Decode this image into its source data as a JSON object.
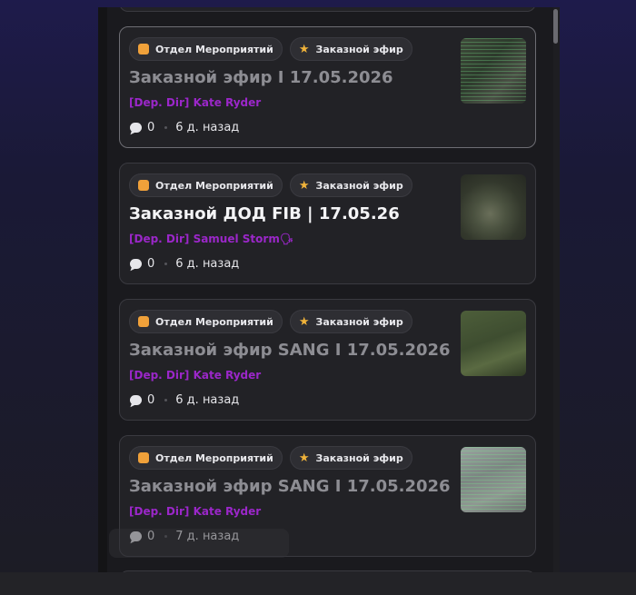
{
  "feed": {
    "cards": [
      {
        "tags": [
          {
            "label": "Отдел Мероприятий",
            "icon": "orange-square-icon"
          },
          {
            "label": "Заказной эфир",
            "icon": "star-icon"
          }
        ],
        "title": "Заказной эфир I 17.05.2026",
        "author": "[Dep. Dir] Kate Ryder",
        "comments": "0",
        "time": "6 д. назад",
        "title_bright": false,
        "active": true
      },
      {
        "tags": [
          {
            "label": "Отдел Мероприятий",
            "icon": "orange-square-icon"
          },
          {
            "label": "Заказной эфир",
            "icon": "star-icon"
          }
        ],
        "title": "Заказной ДОД FIB | 17.05.26",
        "author": "[Dep. Dir] Samuel Storm🗣",
        "comments": "0",
        "time": "6 д. назад",
        "title_bright": true,
        "active": false
      },
      {
        "tags": [
          {
            "label": "Отдел Мероприятий",
            "icon": "orange-square-icon"
          },
          {
            "label": "Заказной эфир",
            "icon": "star-icon"
          }
        ],
        "title": "Заказной эфир SANG I 17.05.2026",
        "author": "[Dep. Dir] Kate Ryder",
        "comments": "0",
        "time": "6 д. назад",
        "title_bright": false,
        "active": false
      },
      {
        "tags": [
          {
            "label": "Отдел Мероприятий",
            "icon": "orange-square-icon"
          },
          {
            "label": "Заказной эфир",
            "icon": "star-icon"
          }
        ],
        "title": "Заказной эфир SANG I 17.05.2026",
        "author": "[Dep. Dir] Kate Ryder",
        "comments": "0",
        "time": "7 д. назад",
        "title_bright": false,
        "active": false
      }
    ]
  },
  "colors": {
    "author": "#9b27c9",
    "tag_square": "#f0a13a",
    "tag_star": "#f0b33a"
  }
}
